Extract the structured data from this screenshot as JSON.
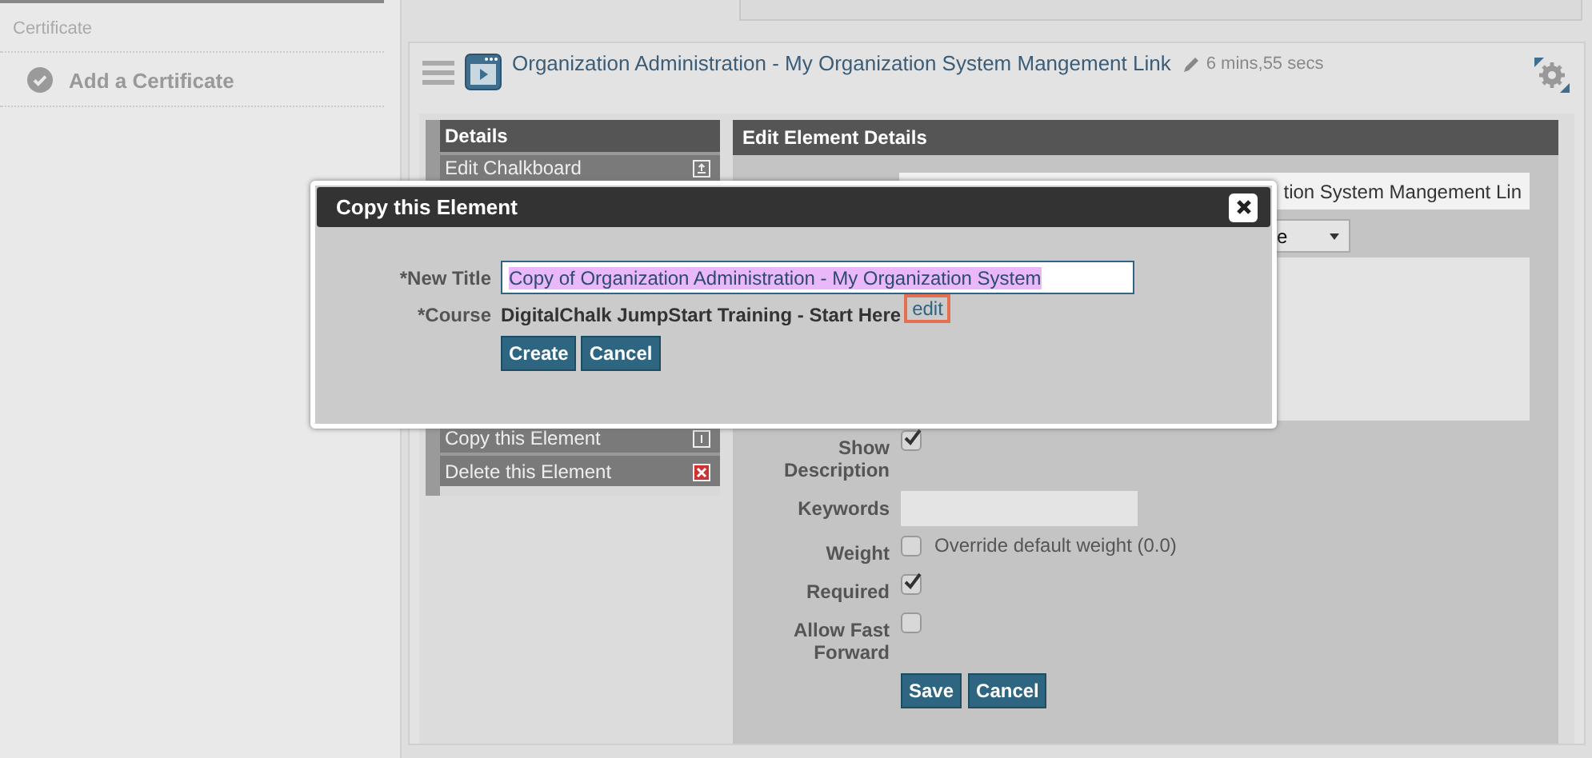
{
  "sidebar": {
    "heading": "Certificate",
    "items": [
      {
        "label": "Add a Certificate"
      }
    ]
  },
  "element": {
    "title": "Organization Administration - My Organization System Mangement Link",
    "duration": "6 mins,55 secs"
  },
  "details_menu": {
    "title": "Details",
    "items": [
      {
        "label": "Edit Chalkboard",
        "kind": "edit"
      },
      {
        "label": "Copy this Element",
        "kind": "copy"
      },
      {
        "label": "Delete this Element",
        "kind": "delete"
      }
    ]
  },
  "edit_panel": {
    "title": "Edit Element Details",
    "title_field": {
      "value": "tion System Mangement Lin"
    },
    "type_select": {
      "value": "e"
    },
    "fields": [
      {
        "label": "Show Description",
        "kind": "checkbox",
        "checked": true
      },
      {
        "label": "Keywords",
        "kind": "text"
      },
      {
        "label": "Weight",
        "kind": "checkbox",
        "checked": false,
        "text": "Override default weight (0.0)"
      },
      {
        "label": "Required",
        "kind": "checkbox",
        "checked": true
      },
      {
        "label": "Allow Fast Forward",
        "kind": "checkbox",
        "checked": false
      }
    ],
    "buttons": [
      "Save",
      "Cancel"
    ]
  },
  "dialog": {
    "title": "Copy this Element",
    "new_title_label": "*New Title",
    "new_title_value": "Copy of Organization Administration - My Organization System",
    "course_label": "*Course",
    "course": "DigitalChalk JumpStart Training - Start Here",
    "edit_link": "edit",
    "buttons": [
      "Create",
      "Cancel"
    ]
  }
}
